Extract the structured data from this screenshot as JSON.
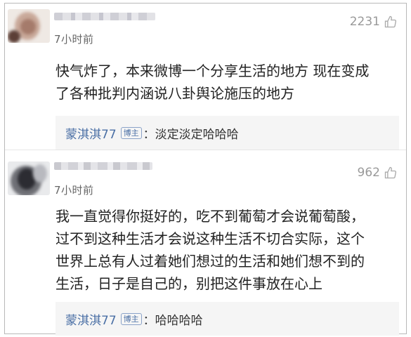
{
  "comments": [
    {
      "time": "7小时前",
      "likes": "2231",
      "body": "快气炸了，本来微博一个分享生活的地方 现在变成\n了各种批判内涵说八卦舆论施压的地方",
      "reply": {
        "name": "蒙淇淇77",
        "badge": "博主",
        "text": "：淡定淡定哈哈哈"
      }
    },
    {
      "time": "7小时前",
      "likes": "962",
      "body": "我一直觉得你挺好的，吃不到葡萄才会说葡萄酸，\n过不到这种生活才会说这种生活不切合实际，这个\n世界上总有人过着她们想过的生活和她们想不到的\n生活，日子是自己的，别把这件事放在心上",
      "reply": {
        "name": "蒙淇淇77",
        "badge": "博主",
        "text": "：哈哈哈哈"
      }
    }
  ],
  "icons": {
    "like": "thumbs-up-outline-icon"
  },
  "colors": {
    "reply_name": "#4a6fa5",
    "reply_bg": "#f5f5f5",
    "meta": "#999999"
  }
}
